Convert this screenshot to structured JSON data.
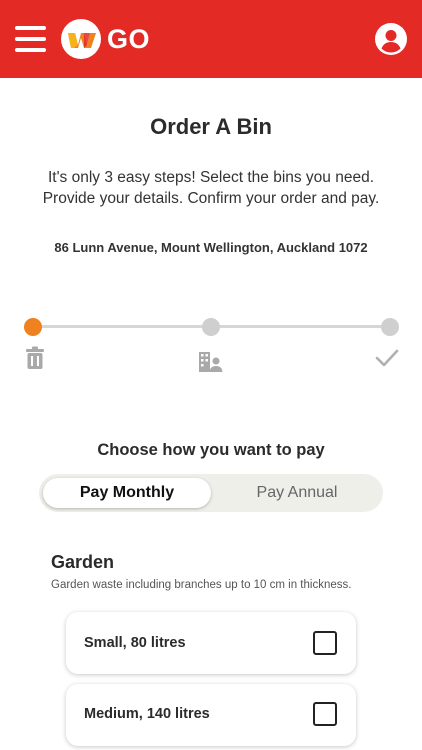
{
  "header": {
    "logo_text": "GO",
    "brand_color": "#e32a25",
    "menu_icon": "hamburger-menu-icon",
    "account_icon": "account-circle-icon"
  },
  "page": {
    "title": "Order A Bin",
    "intro_lines": [
      "It's only 3 easy steps! Select the bins you need.",
      "Provide your details. Confirm your order and pay."
    ],
    "address": "86 Lunn Avenue, Mount Wellington, Auckland 1072"
  },
  "stepper": {
    "active_step": 1,
    "active_color": "#f0811f",
    "steps": [
      {
        "icon": "trash-bin-icon"
      },
      {
        "icon": "building-person-icon"
      },
      {
        "icon": "checkmark-icon"
      }
    ]
  },
  "payment": {
    "heading": "Choose how you want to pay",
    "options": [
      "Pay Monthly",
      "Pay Annual"
    ],
    "selected": "Pay Monthly"
  },
  "garden": {
    "title": "Garden",
    "description": "Garden waste including branches up to 10 cm in thickness.",
    "bins": [
      {
        "label": "Small, 80 litres",
        "checked": false
      },
      {
        "label": "Medium, 140 litres",
        "checked": false
      }
    ]
  }
}
